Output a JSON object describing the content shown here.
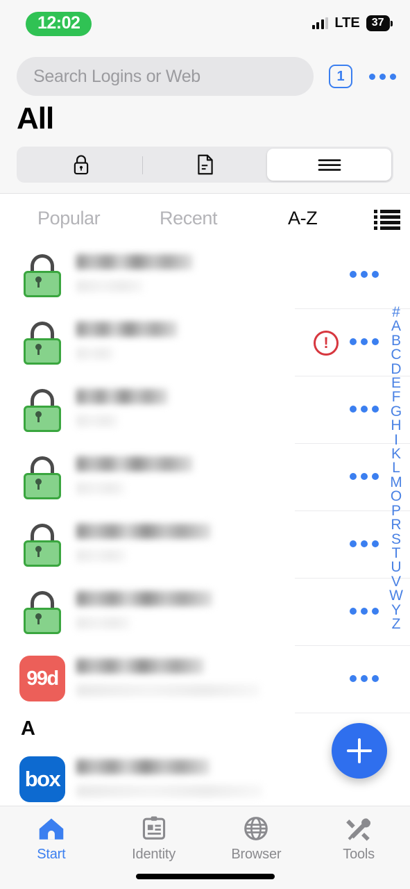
{
  "status_bar": {
    "time": "12:02",
    "network_label": "LTE",
    "battery_level": "37",
    "time_pill_color": "#30c254",
    "battery_pill_color": "#0b0b0b"
  },
  "header": {
    "search_placeholder": "Search Logins or Web",
    "search_value": "",
    "tab_count": "1",
    "overflow_label": "•••",
    "page_title": "All",
    "accent_color": "#3b7ff0",
    "segmented": [
      {
        "id": "logins",
        "icon": "lock-icon",
        "selected": false
      },
      {
        "id": "documents",
        "icon": "document-icon",
        "selected": false
      },
      {
        "id": "all",
        "icon": "list-lines-icon",
        "selected": true
      }
    ]
  },
  "sort_tabs": {
    "items": [
      {
        "label": "Popular",
        "active": false
      },
      {
        "label": "Recent",
        "active": false
      },
      {
        "label": "A-Z",
        "active": true
      }
    ],
    "view_toggle_icon": "list-view-icon"
  },
  "list": {
    "rows": [
      {
        "kind": "entry",
        "icon": "padlock-icon",
        "title_redacted": true,
        "subtitle_redacted": true,
        "title_width": 168,
        "subtitle_width": 96,
        "warning": false,
        "menu": "•••"
      },
      {
        "kind": "entry",
        "icon": "padlock-icon",
        "title_redacted": true,
        "subtitle_redacted": true,
        "title_width": 146,
        "subtitle_width": 54,
        "warning": true,
        "menu": "•••"
      },
      {
        "kind": "entry",
        "icon": "padlock-icon",
        "title_redacted": true,
        "subtitle_redacted": true,
        "title_width": 132,
        "subtitle_width": 60,
        "warning": false,
        "menu": "•••"
      },
      {
        "kind": "entry",
        "icon": "padlock-icon",
        "title_redacted": true,
        "subtitle_redacted": true,
        "title_width": 168,
        "subtitle_width": 70,
        "warning": false,
        "menu": "•••"
      },
      {
        "kind": "entry",
        "icon": "padlock-icon",
        "title_redacted": true,
        "subtitle_redacted": true,
        "title_width": 194,
        "subtitle_width": 72,
        "warning": false,
        "menu": "•••"
      },
      {
        "kind": "entry",
        "icon": "padlock-icon",
        "title_redacted": true,
        "subtitle_redacted": true,
        "title_width": 196,
        "subtitle_width": 78,
        "warning": false,
        "menu": "•••"
      },
      {
        "kind": "entry",
        "icon": "99designs-app-icon",
        "icon_label": "99d",
        "icon_color": "#ec5f59",
        "title_redacted": true,
        "subtitle_redacted": true,
        "title_width": 184,
        "subtitle_width": 264,
        "warning": false,
        "menu": "•••"
      },
      {
        "kind": "section",
        "label": "A"
      },
      {
        "kind": "entry",
        "icon": "box-app-icon",
        "icon_label": "box",
        "icon_color": "#0d6ad0",
        "title_redacted": true,
        "subtitle_redacted": true,
        "title_width": 192,
        "subtitle_width": 268,
        "warning": false,
        "menu": ""
      }
    ]
  },
  "alpha_index": {
    "letters": [
      "#",
      "A",
      "B",
      "C",
      "D",
      "E",
      "F",
      "G",
      "H",
      "I",
      "K",
      "L",
      "M",
      "O",
      "P",
      "R",
      "S",
      "T",
      "U",
      "V",
      "W",
      "Y",
      "Z"
    ],
    "color": "#4a82e4"
  },
  "fab": {
    "icon": "plus-icon",
    "color": "#2f6fee"
  },
  "bottom_nav": {
    "items": [
      {
        "label": "Start",
        "icon": "home-icon",
        "active": true
      },
      {
        "label": "Identity",
        "icon": "id-card-icon",
        "active": false
      },
      {
        "label": "Browser",
        "icon": "globe-icon",
        "active": false
      },
      {
        "label": "Tools",
        "icon": "tools-icon",
        "active": false
      }
    ],
    "active_color": "#3b7ff0",
    "inactive_color": "#8a8a8e"
  }
}
